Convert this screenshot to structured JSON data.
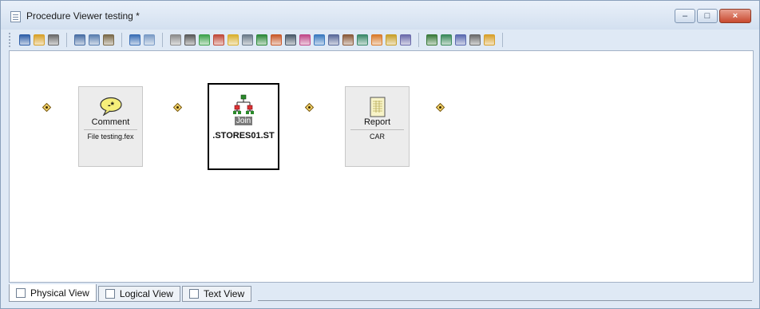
{
  "window": {
    "title": "Procedure Viewer testing *",
    "buttons": {
      "minimize": "–",
      "maximize": "□",
      "close": "×"
    }
  },
  "toolbar": {
    "groups": [
      [
        {
          "name": "save-icon",
          "color": "#2f5fa8"
        },
        {
          "name": "open-icon",
          "color": "#d8a12a"
        },
        {
          "name": "print-icon",
          "color": "#6a6a6a"
        }
      ],
      [
        {
          "name": "cut-icon",
          "color": "#4a6fa5"
        },
        {
          "name": "copy-icon",
          "color": "#5a7fb0"
        },
        {
          "name": "paste-icon",
          "color": "#7a6a4a"
        }
      ],
      [
        {
          "name": "undo-icon",
          "color": "#3b6fb6"
        },
        {
          "name": "redo-icon",
          "color": "#7a9bc6"
        }
      ],
      [
        {
          "name": "report-icon",
          "color": "#8c8c8c"
        },
        {
          "name": "sql-icon",
          "color": "#5a5a5a"
        },
        {
          "name": "graph-icon",
          "color": "#3fa34d"
        },
        {
          "name": "define-icon",
          "color": "#c04a3a"
        },
        {
          "name": "chart-icon",
          "color": "#d9b02f"
        },
        {
          "name": "file-icon",
          "color": "#6a7a8a"
        },
        {
          "name": "join-icon",
          "color": "#2d8a3a"
        },
        {
          "name": "match-icon",
          "color": "#c85a2a"
        },
        {
          "name": "document-icon",
          "color": "#4a5a6a"
        },
        {
          "name": "brush-icon",
          "color": "#c04a8a"
        },
        {
          "name": "globe-icon",
          "color": "#3a7ac0"
        },
        {
          "name": "output-icon",
          "color": "#5a6a9a"
        },
        {
          "name": "help-icon",
          "color": "#8a5a3a"
        },
        {
          "name": "tree-icon",
          "color": "#3a8a6a"
        },
        {
          "name": "sql-wand-icon",
          "color": "#d97a2a"
        },
        {
          "name": "flow-icon",
          "color": "#c8a02a"
        },
        {
          "name": "exit-icon",
          "color": "#6a6aaa"
        }
      ],
      [
        {
          "name": "connect-icon",
          "color": "#3a7a3a"
        },
        {
          "name": "link-icon",
          "color": "#3a8a5a"
        },
        {
          "name": "tag-icon",
          "color": "#5a6ab0"
        },
        {
          "name": "component-icon",
          "color": "#6a6a6a"
        },
        {
          "name": "diamond-icon",
          "color": "#d8a02a"
        }
      ]
    ]
  },
  "nodes": [
    {
      "id": "comment",
      "title": "Comment",
      "subtitle": "File testing.fex",
      "selected": false
    },
    {
      "id": "join",
      "title": "Join",
      "subtitle": ".STORES01.ST",
      "selected": true
    },
    {
      "id": "report",
      "title": "Report",
      "subtitle": "CAR",
      "selected": false
    }
  ],
  "tabs": [
    {
      "label": "Physical View",
      "active": true,
      "icon": "physical-view-icon"
    },
    {
      "label": "Logical View",
      "active": false,
      "icon": "logical-view-icon"
    },
    {
      "label": "Text View",
      "active": false,
      "icon": "text-view-icon"
    }
  ]
}
